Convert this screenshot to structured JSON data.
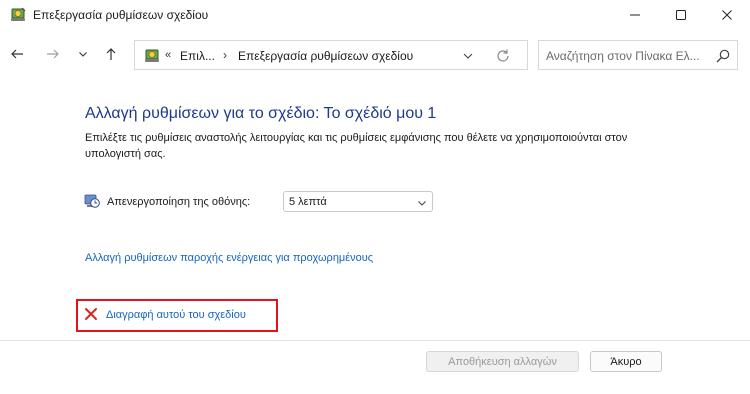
{
  "window": {
    "title": "Επεξεργασία ρυθμίσεων σχεδίου"
  },
  "navigation": {
    "breadcrumb_chevron": "«",
    "breadcrumb_segment_1": "Επιλ...",
    "breadcrumb_separator": "›",
    "breadcrumb_segment_2": "Επεξεργασία ρυθμίσεων σχεδίου",
    "search_placeholder": "Αναζήτηση στον Πίνακα Ελ..."
  },
  "main": {
    "heading": "Αλλαγή ρυθμίσεων για το σχέδιο: Το σχέδιό μου 1",
    "description": "Επιλέξτε τις ρυθμίσεις αναστολής λειτουργίας και τις ρυθμίσεις εμφάνισης που θέλετε να χρησιμοποιούνται στον υπολογιστή σας.",
    "display_off_label": "Απενεργοποίηση της οθόνης:",
    "display_off_value": "5 λεπτά",
    "advanced_link": "Αλλαγή ρυθμίσεων παροχής ενέργειας για προχωρημένους",
    "delete_link": "Διαγραφή αυτού του σχεδίου"
  },
  "footer": {
    "save_label": "Αποθήκευση αλλαγών",
    "cancel_label": "Άκυρο"
  },
  "icons": {
    "app": "power-options-icon",
    "back": "back-arrow-icon",
    "forward": "forward-arrow-icon",
    "recent": "chevron-down-icon",
    "up": "up-arrow-icon",
    "refresh": "refresh-icon",
    "search": "search-icon",
    "display": "display-clock-icon",
    "delete": "red-x-icon"
  },
  "colors": {
    "heading": "#1e3a8a",
    "link": "#1565c0",
    "highlight_border": "#e3131b"
  }
}
